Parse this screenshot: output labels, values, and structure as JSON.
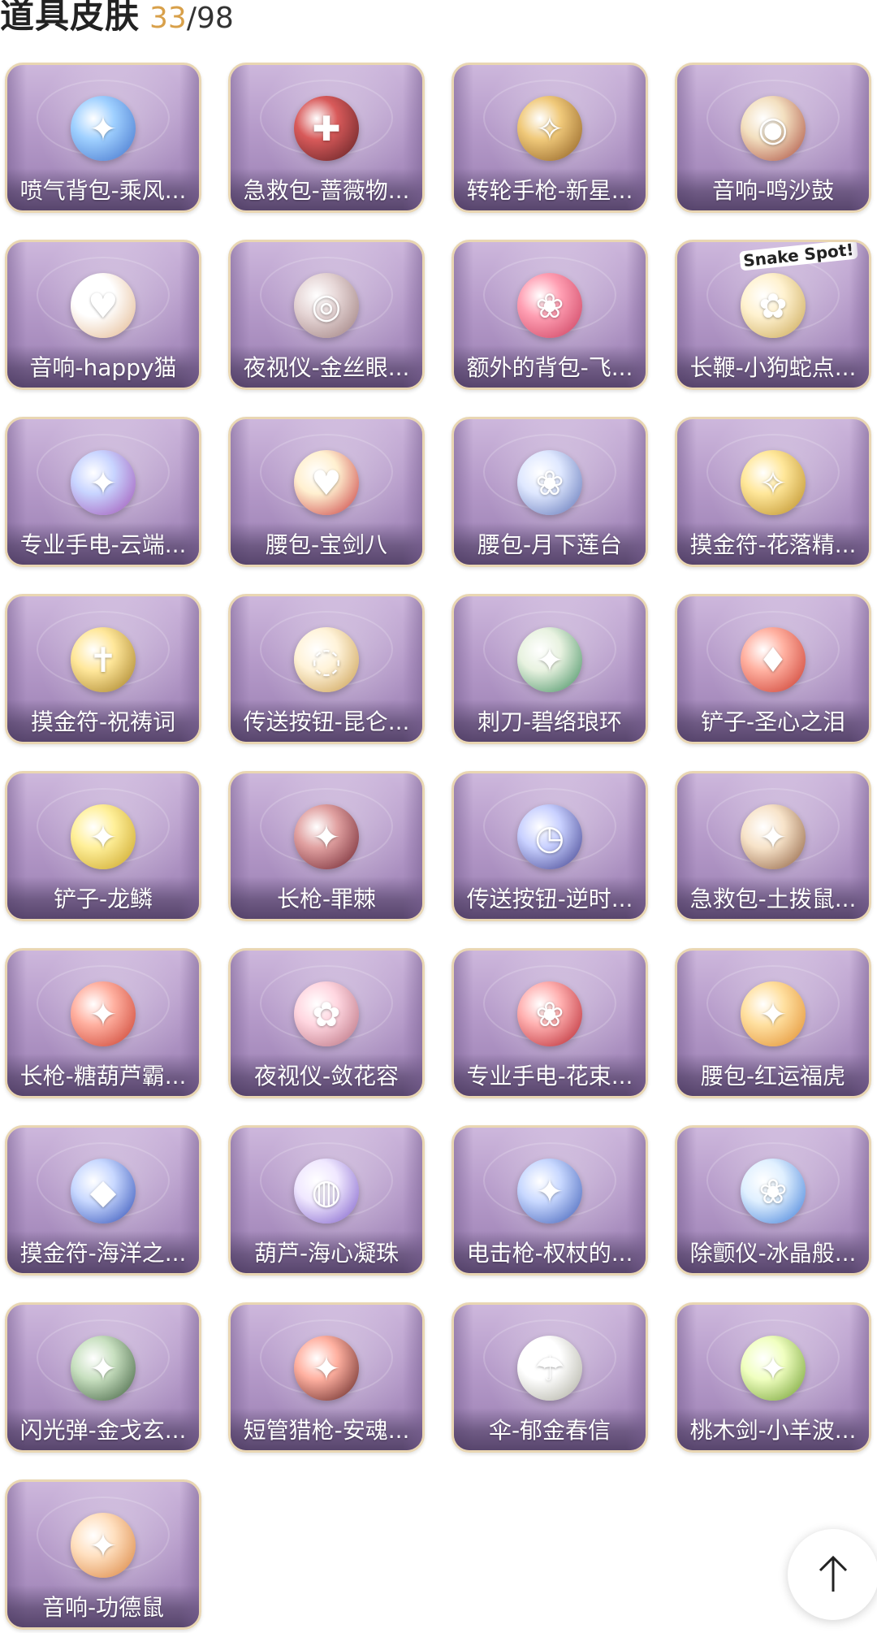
{
  "header": {
    "title": "道具皮肤",
    "owned": "33",
    "separator": "/",
    "total": "98"
  },
  "colors": {
    "owned_count": "#d8a04a",
    "card_border": "#e9d6b2",
    "card_bg": "#b59ac9"
  },
  "items": [
    {
      "label": "喷气背包-乘风...",
      "icon": "jetpack-icon",
      "c1": "#9fd0ff",
      "c2": "#3f6fc9"
    },
    {
      "label": "急救包-蔷薇物...",
      "icon": "first-aid-kit-icon",
      "c1": "#d85a5a",
      "c2": "#5a1e22"
    },
    {
      "label": "转轮手枪-新星...",
      "icon": "revolver-icon",
      "c1": "#f0c97a",
      "c2": "#8a5a1e"
    },
    {
      "label": "音响-鸣沙鼓",
      "icon": "drum-icon",
      "c1": "#f3e0c0",
      "c2": "#a8483a"
    },
    {
      "label": "音响-happy猫",
      "icon": "cat-speaker-icon",
      "c1": "#ffffff",
      "c2": "#e2b489"
    },
    {
      "label": "夜视仪-金丝眼...",
      "icon": "glasses-icon",
      "c1": "#e6d6d6",
      "c2": "#9a7a7a"
    },
    {
      "label": "额外的背包-飞...",
      "icon": "flower-backpack-icon",
      "c1": "#ff9fb3",
      "c2": "#c83a5a"
    },
    {
      "label": "长鞭-小狗蛇点...",
      "icon": "snake-whip-icon",
      "c1": "#fff2d0",
      "c2": "#c8a450",
      "badge": "Snake Spot!"
    },
    {
      "label": "专业手电-云端...",
      "icon": "flashlight-icon",
      "c1": "#c8d4ff",
      "c2": "#a04fb4"
    },
    {
      "label": "腰包-宝剑八",
      "icon": "heart-pouch-icon",
      "c1": "#fff0d0",
      "c2": "#c8363a"
    },
    {
      "label": "腰包-月下莲台",
      "icon": "lotus-pouch-icon",
      "c1": "#dfe8ff",
      "c2": "#5a6fb4"
    },
    {
      "label": "摸金符-花落精...",
      "icon": "charm-icon",
      "c1": "#ffe79a",
      "c2": "#b88a22"
    },
    {
      "label": "摸金符-祝祷词",
      "icon": "cross-charm-icon",
      "c1": "#ffe79a",
      "c2": "#a07a20"
    },
    {
      "label": "传送按钮-昆仑...",
      "icon": "ring-portal-icon",
      "c1": "#fff3d9",
      "c2": "#c89a4a"
    },
    {
      "label": "刺刀-碧络琅环",
      "icon": "dagger-icon",
      "c1": "#e8f2e0",
      "c2": "#3a8a5a"
    },
    {
      "label": "铲子-圣心之泪",
      "icon": "shovel-icon",
      "c1": "#ffb0a0",
      "c2": "#c8362a"
    },
    {
      "label": "铲子-龙鳞",
      "icon": "gold-shovel-icon",
      "c1": "#fff09a",
      "c2": "#c8a020"
    },
    {
      "label": "长枪-罪棘",
      "icon": "spear-icon",
      "c1": "#e0a0a0",
      "c2": "#6a1e2a"
    },
    {
      "label": "传送按钮-逆时...",
      "icon": "pocket-watch-icon",
      "c1": "#c8d0ff",
      "c2": "#3a3a8a"
    },
    {
      "label": "急救包-土拨鼠...",
      "icon": "hamster-kit-icon",
      "c1": "#f7e3c9",
      "c2": "#8a5a3a"
    },
    {
      "label": "长枪-糖葫芦霸...",
      "icon": "candy-spear-icon",
      "c1": "#ffb0a0",
      "c2": "#c83a2a"
    },
    {
      "label": "夜视仪-敛花容",
      "icon": "floral-goggles-icon",
      "c1": "#ffd6e0",
      "c2": "#b46a7a"
    },
    {
      "label": "专业手电-花束...",
      "icon": "rose-bouquet-icon",
      "c1": "#ffb0b0",
      "c2": "#b4202a"
    },
    {
      "label": "腰包-红运福虎",
      "icon": "tiger-pouch-icon",
      "c1": "#ffe0a0",
      "c2": "#e08a2a"
    },
    {
      "label": "摸金符-海洋之...",
      "icon": "ocean-charm-icon",
      "c1": "#c8d8ff",
      "c2": "#2a4ab4"
    },
    {
      "label": "葫芦-海心凝珠",
      "icon": "shell-pearl-icon",
      "c1": "#f0e8ff",
      "c2": "#7a5ac8"
    },
    {
      "label": "电击枪-权杖的...",
      "icon": "scepter-icon",
      "c1": "#c8d8ff",
      "c2": "#3a5ab4"
    },
    {
      "label": "除颤仪-冰晶般...",
      "icon": "crystal-lotus-icon",
      "c1": "#e0f0ff",
      "c2": "#3a7ad8"
    },
    {
      "label": "闪光弹-金戈玄...",
      "icon": "flashbang-icon",
      "c1": "#c8e0c0",
      "c2": "#3a5a3a"
    },
    {
      "label": "短管猎枪-安魂...",
      "icon": "shotgun-icon",
      "c1": "#ffb0a0",
      "c2": "#5a1e1e"
    },
    {
      "label": "伞-郁金春信",
      "icon": "umbrella-icon",
      "c1": "#ffffff",
      "c2": "#a8a89a"
    },
    {
      "label": "桃木剑-小羊波...",
      "icon": "sword-icon",
      "c1": "#f0ffc0",
      "c2": "#6a9a2a"
    },
    {
      "label": "音响-功德鼠",
      "icon": "mouse-speaker-icon",
      "c1": "#ffe0c0",
      "c2": "#d8803a"
    }
  ],
  "scroll_top": {
    "icon": "arrow-up-icon"
  }
}
